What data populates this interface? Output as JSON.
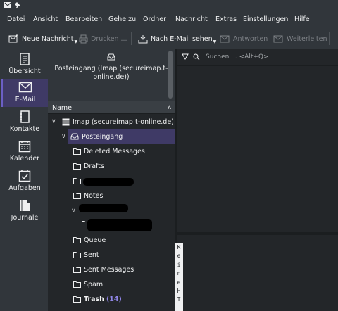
{
  "menubar": {
    "items": [
      "Datei",
      "Ansicht",
      "Bearbeiten",
      "Gehe zu",
      "Ordner",
      "Nachricht",
      "Extras",
      "Einstellungen",
      "Hilfe"
    ]
  },
  "toolbar": {
    "new_message": "Neue Nachricht",
    "print": "Drucken ...",
    "check_mail": "Nach E-Mail sehen",
    "reply": "Antworten",
    "forward": "Weiterleiten"
  },
  "sidebar": {
    "items": [
      {
        "label": "Übersicht",
        "icon": "overview-icon"
      },
      {
        "label": "E-Mail",
        "icon": "mail-icon",
        "active": true
      },
      {
        "label": "Kontakte",
        "icon": "contacts-icon"
      },
      {
        "label": "Kalender",
        "icon": "calendar-icon"
      },
      {
        "label": "Aufgaben",
        "icon": "tasks-icon"
      },
      {
        "label": "Journale",
        "icon": "journal-icon"
      }
    ]
  },
  "folder_header": {
    "label": "Posteingang (Imap (secureimap.t-online.de))"
  },
  "folder_tree": {
    "column_header": "Name",
    "account": "Imap (secureimap.t-online.de)",
    "inbox": "Posteingang",
    "folders": [
      {
        "label": "Deleted Messages"
      },
      {
        "label": "Drafts"
      },
      {
        "label": "Notes"
      },
      {
        "label": "Queue"
      },
      {
        "label": "Sent"
      },
      {
        "label": "Sent Messages"
      },
      {
        "label": "Spam"
      },
      {
        "label": "Trash",
        "count": "(14)"
      }
    ]
  },
  "search": {
    "placeholder": "Suchen ... <Alt+Q>"
  },
  "preview": {
    "vertical_text": [
      "K",
      "e",
      "i",
      "n",
      "e",
      "",
      "H",
      "T"
    ]
  },
  "colors": {
    "selection": "#3f3a66",
    "accent": "#8f85e6",
    "background": "#232629",
    "panel": "#31363b"
  }
}
